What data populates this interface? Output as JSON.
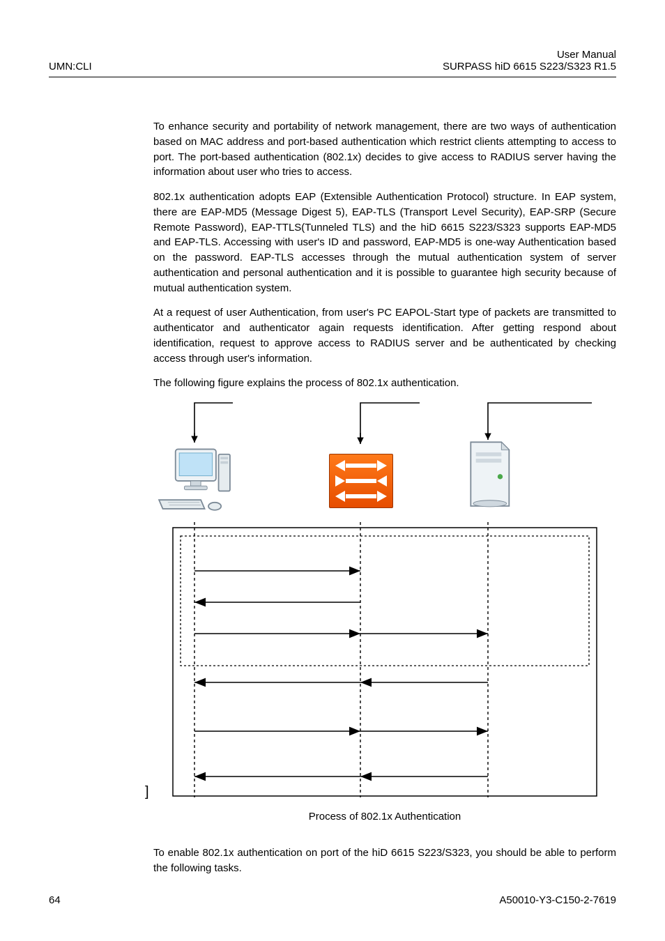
{
  "header": {
    "left": "UMN:CLI",
    "right1": "User Manual",
    "right2": "SURPASS hiD 6615 S223/S323 R1.5"
  },
  "paragraphs": {
    "p1": "To enhance security and portability of network management, there are two ways of authentication based on MAC address and port-based authentication which restrict clients attempting to access to port. The port-based authentication (802.1x) decides to give access to RADIUS server having the information about user who tries to access.",
    "p2": "802.1x authentication adopts EAP (Extensible Authentication Protocol) structure. In EAP system, there are EAP-MD5 (Message Digest 5), EAP-TLS (Transport Level Security), EAP-SRP (Secure Remote Password), EAP-TTLS(Tunneled TLS) and the hiD 6615 S223/S323 supports EAP-MD5 and EAP-TLS. Accessing with user's ID and password, EAP-MD5 is one-way Authentication based on the password. EAP-TLS accesses through the mutual authentication system of server authentication and personal authentication and it is possible to guarantee high security because of mutual authentication system.",
    "p3": "At a request of user Authentication, from user's PC EAPOL-Start type of packets are transmitted to authenticator and authenticator again requests identification. After getting respond about identification, request to approve access to RADIUS server and be authenticated by checking access through user's information.",
    "p4": "The following figure explains the process of 802.1x authentication."
  },
  "figure": {
    "caption": "Process of 802.1x Authentication"
  },
  "after": {
    "p5": "To enable 802.1x authentication on port of the hiD 6615 S223/S323, you should be able to perform the following tasks."
  },
  "footer": {
    "page": "64",
    "ref": "A50010-Y3-C150-2-7619"
  }
}
